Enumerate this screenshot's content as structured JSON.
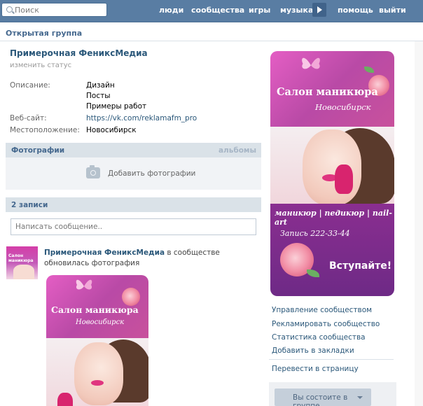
{
  "search": {
    "placeholder": "Поиск"
  },
  "nav": {
    "people": "люди",
    "communities": "сообщества",
    "games": "игры",
    "music": "музыка",
    "help": "помощь",
    "logout": "выйти"
  },
  "header": {
    "title": "Открытая группа"
  },
  "group": {
    "name": "Примерочная ФениксМедиа",
    "change_status": "изменить статус",
    "desc_label": "Описание:",
    "desc_lines": [
      "Дизайн",
      "Посты",
      "Примеры работ"
    ],
    "site_label": "Веб-сайт:",
    "site": "https://vk.com/reklamafm_pro",
    "location_label": "Местоположение:",
    "location": "Новосибирск"
  },
  "photos": {
    "title": "Фотографии",
    "albums": "альбомы",
    "add": "Добавить фотографии"
  },
  "wall": {
    "count": "2 записи",
    "placeholder": "Написать сообщение.."
  },
  "post": {
    "author": "Примерочная ФениксМедиа",
    "text": "в сообществе обновилась фотография"
  },
  "banner": {
    "title": "Салон маникюра",
    "city": "Новосибирск",
    "services": "маникюр | педикюр | nail-art",
    "phone": "Запись 222-33-44",
    "cta": "Вступайте!"
  },
  "avatar": {
    "title": "Салон маникюра"
  },
  "menu": {
    "manage": "Управление сообществом",
    "advertise": "Рекламировать сообщество",
    "stats": "Статистика сообщества",
    "bookmark": "Добавить в закладки",
    "to_page": "Перевести в страницу"
  },
  "join": {
    "label": "Вы состоите в группе"
  },
  "colors": {
    "topbar": "#597da3",
    "link": "#2b587a",
    "section": "#dae2e8",
    "banner_pink": "#d94fb5",
    "banner_purple": "#7a2c8c"
  }
}
